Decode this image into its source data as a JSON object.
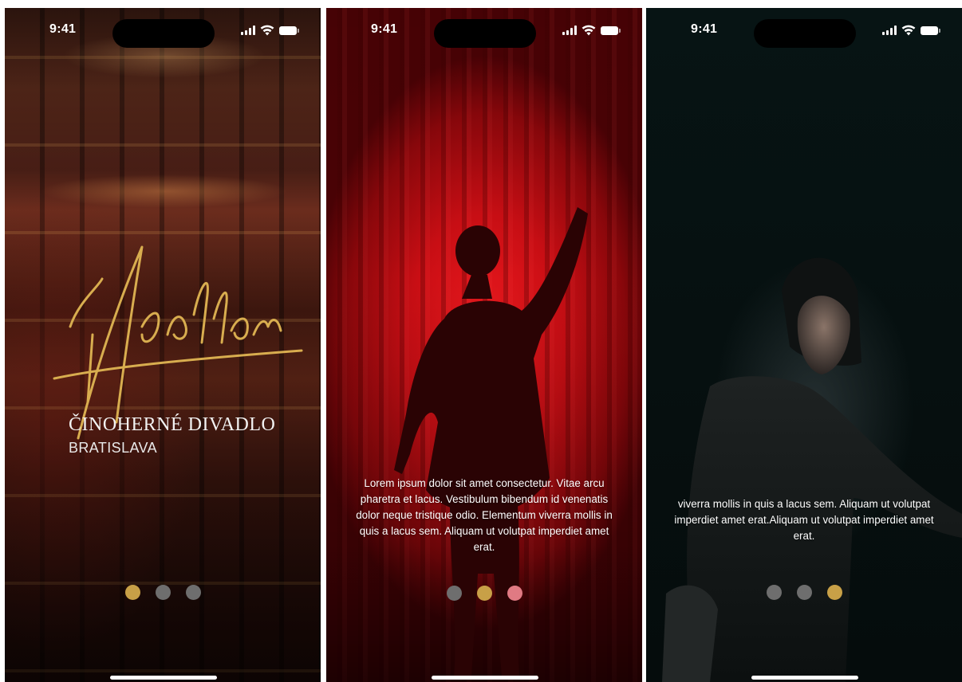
{
  "colors": {
    "accent_gold": "#c8a047",
    "dot_inactive": "#6e6e6e",
    "text_primary": "#ffffff",
    "curtain_red": "#d4111a",
    "dark_bg": "#061010"
  },
  "status_bar": {
    "time": "9:41",
    "icons": [
      "signal-icon",
      "wifi-icon",
      "battery-icon"
    ]
  },
  "screens": [
    {
      "id": "splash",
      "logo_text": "Apollon",
      "theatre_name": "ČINOHERNÉ DIVADLO",
      "city": "BRATISLAVA",
      "pager": {
        "count": 3,
        "active_index": 0
      }
    },
    {
      "id": "intro-1",
      "body": "Lorem ipsum dolor sit amet consectetur. Vitae arcu pharetra et lacus. Vestibulum bibendum id venenatis dolor neque tristique odio. Elementum viverra mollis in quis a lacus sem. Aliquam ut volutpat imperdiet amet erat.",
      "pager": {
        "count": 3,
        "active_index": 1
      }
    },
    {
      "id": "intro-2",
      "body": "viverra mollis in quis a lacus sem. Aliquam ut volutpat imperdiet amet erat.Aliquam ut volutpat imperdiet amet erat.",
      "pager": {
        "count": 3,
        "active_index": 2
      }
    }
  ]
}
